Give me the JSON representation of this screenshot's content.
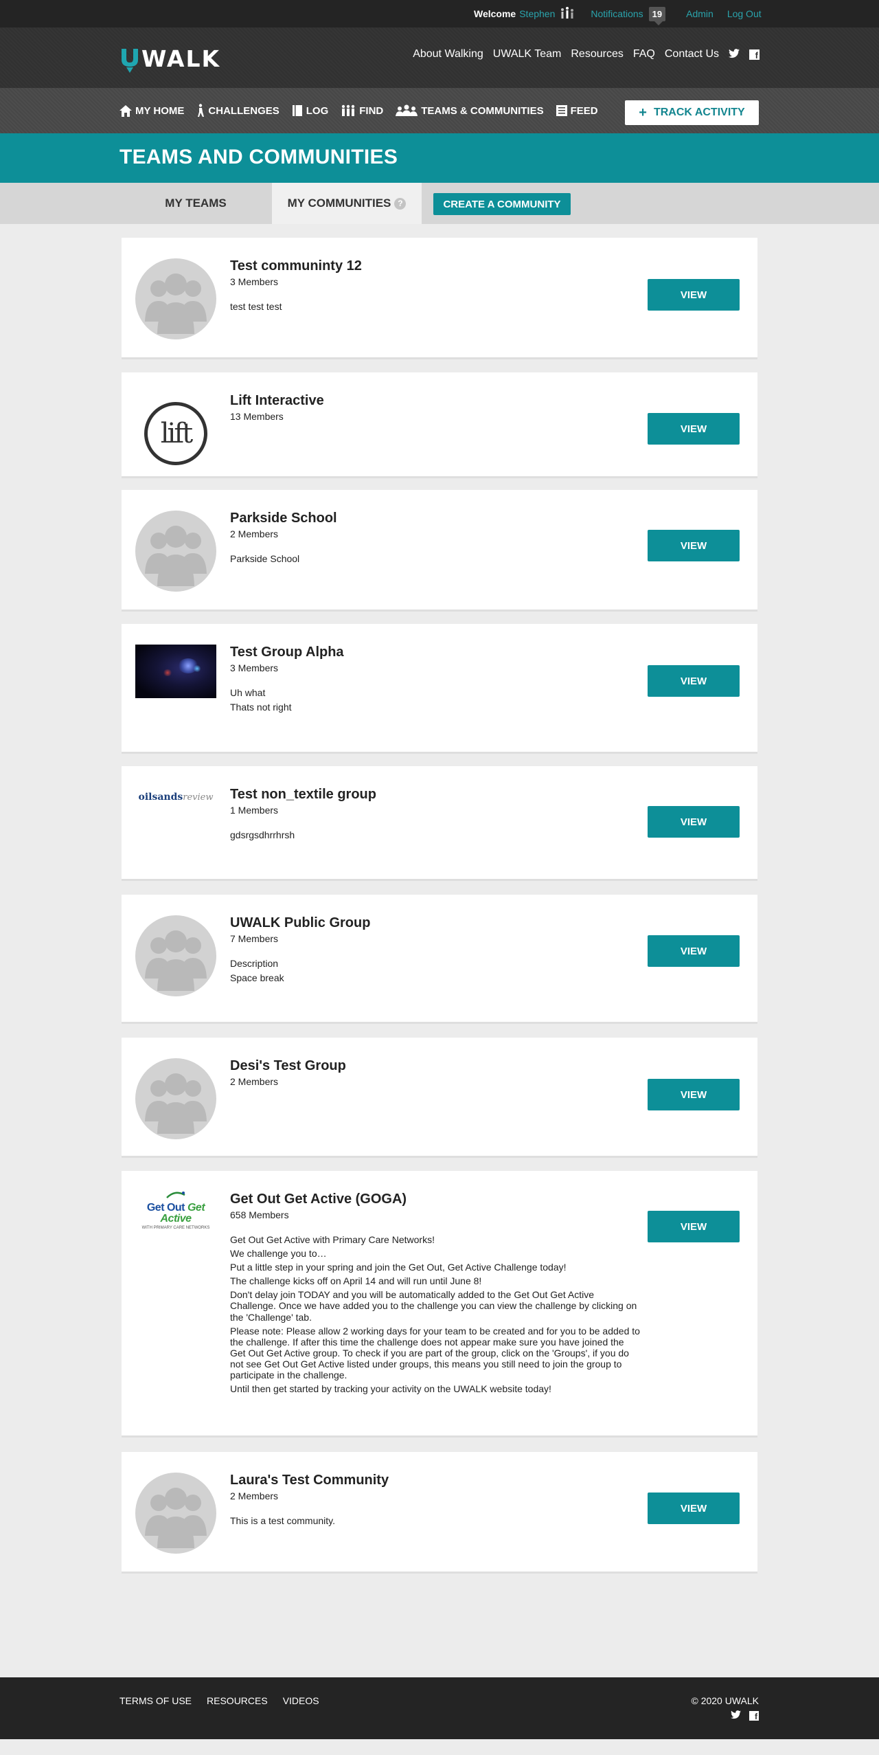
{
  "topbar": {
    "welcome": "Welcome",
    "username": "Stephen",
    "notifications_label": "Notifications",
    "notifications_count": "19",
    "admin": "Admin",
    "logout": "Log Out"
  },
  "header": {
    "logo_text": "WALK",
    "nav": [
      "About Walking",
      "UWALK Team",
      "Resources",
      "FAQ",
      "Contact Us"
    ]
  },
  "subnav": {
    "items": [
      "MY HOME",
      "CHALLENGES",
      "LOG",
      "FIND",
      "TEAMS & COMMUNITIES",
      "FEED"
    ],
    "track_button": "TRACK ACTIVITY"
  },
  "page": {
    "title": "TEAMS AND COMMUNITIES"
  },
  "tabs": {
    "my_teams": "MY TEAMS",
    "my_communities": "MY COMMUNITIES",
    "help": "?",
    "create": "CREATE A COMMUNITY"
  },
  "communities": [
    {
      "name": "Test communinty 12",
      "members": "3 Members",
      "description": [
        "test test test"
      ],
      "image": "placeholder-avatar"
    },
    {
      "name": "Lift Interactive",
      "members": "13 Members",
      "description": [],
      "image": "lift-logo"
    },
    {
      "name": "Parkside School",
      "members": "2 Members",
      "description": [
        "Parkside School"
      ],
      "image": "placeholder-avatar"
    },
    {
      "name": "Test Group Alpha",
      "members": "3 Members",
      "description": [
        "Uh what",
        "Thats not right"
      ],
      "image": "dark-photo"
    },
    {
      "name": "Test non_textile group",
      "members": "1 Members",
      "description": [
        "gdsrgsdhrrhrsh"
      ],
      "image": "oilsands-logo"
    },
    {
      "name": "UWALK Public Group",
      "members": "7 Members",
      "description": [
        "Description",
        "Space break"
      ],
      "image": "placeholder-avatar"
    },
    {
      "name": "Desi's Test Group",
      "members": "2 Members",
      "description": [],
      "image": "placeholder-avatar"
    },
    {
      "name": "Get Out Get Active (GOGA)",
      "members": "658 Members",
      "description": [
        "Get Out Get Active with Primary Care Networks!",
        "We challenge you to…",
        "Put a little step in your spring and join the Get Out, Get Active Challenge today!",
        "The challenge kicks off on April 14 and will run until June 8!",
        "Don't delay join TODAY and you will be automatically added to the Get Out Get Active Challenge. Once we have added you to the challenge you can view the challenge by clicking on the 'Challenge' tab.",
        "Please note: Please allow 2 working days for your team to be created and for you to be added to the challenge. If after this time the challenge does not appear make sure you have joined the Get Out Get Active group. To check if you are part of the group, click on the 'Groups', if you do not see Get Out Get Active listed under groups, this means you still need to join the group to participate in the challenge.",
        "Until then get started by tracking your activity on the UWALK website today!"
      ],
      "image": "goga-logo"
    },
    {
      "name": "Laura's Test Community",
      "members": "2 Members",
      "description": [
        "This is a test community."
      ],
      "image": "placeholder-avatar"
    }
  ],
  "view_label": "VIEW",
  "logos": {
    "lift": "lift",
    "oilsands": "oilsands",
    "oilsands_suffix": "review",
    "goga_line1a": "Get Out",
    "goga_line1b": "Get Active",
    "goga_line2": "WITH PRIMARY CARE NETWORKS"
  },
  "footer": {
    "links": [
      "TERMS OF USE",
      "RESOURCES",
      "VIDEOS"
    ],
    "copyright": "© 2020 UWALK"
  },
  "colors": {
    "brand_teal": "#0d8f98",
    "link_teal": "#2aa4ad",
    "dark_bar": "#242424"
  }
}
